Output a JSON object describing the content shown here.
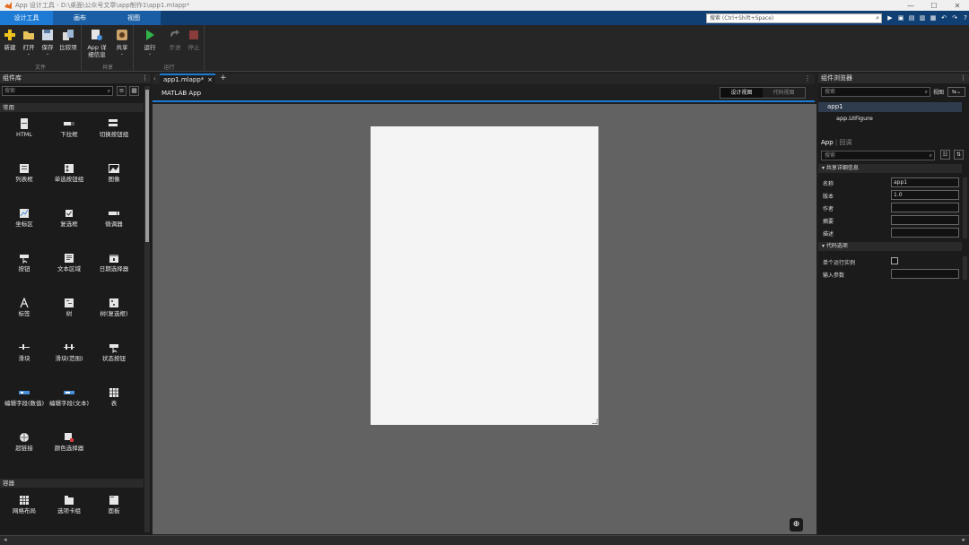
{
  "window": {
    "title": "App 设计工具 - D:\\桌面\\公众号文章\\app制作1\\app1.mlapp*",
    "controls": [
      "—",
      "☐",
      "✕"
    ]
  },
  "ribbon": {
    "tabs": [
      "设计工具",
      "画布",
      "视图"
    ],
    "search_placeholder": "搜索 (Ctrl+Shift+Space)"
  },
  "toolstrip": {
    "groups": {
      "file": "文件",
      "share": "共享",
      "run": "运行"
    },
    "tools": {
      "new": "新建",
      "open": "打开",
      "save": "保存",
      "compare": "比较项",
      "app_details": "App 详细信息",
      "share": "共享",
      "run": "运行",
      "step": "步进",
      "stop": "停止"
    }
  },
  "library": {
    "title": "组件库",
    "search_placeholder": "搜索",
    "sections": [
      "常用",
      "容器"
    ],
    "common": [
      "HTML",
      "下拉框",
      "切换按钮组",
      "列表框",
      "单选按钮组",
      "图像",
      "坐标区",
      "复选框",
      "微调器",
      "按钮",
      "文本区域",
      "日期选择器",
      "标签",
      "树",
      "树(复选框)",
      "滑块",
      "滑块(范围)",
      "状态按钮",
      "编辑字段(数值)",
      "编辑字段(文本)",
      "表",
      "超链接",
      "颜色选择器"
    ],
    "containers": [
      "网格布局",
      "选项卡组",
      "面板"
    ]
  },
  "editor": {
    "tab_label": "app1.mlapp*",
    "app_title": "MATLAB App",
    "view_design": "设计视图",
    "view_code": "代码视图"
  },
  "browser": {
    "title": "组件浏览器",
    "search_placeholder": "搜索",
    "view_label": "视图",
    "tree_root": "app1",
    "tree_child": "app.UIFigure",
    "tab_app": "App",
    "tab_callback": "回调",
    "inspector_search": "搜索",
    "section_details": "共享详细信息",
    "section_code": "代码选项",
    "props": {
      "name_label": "名称",
      "name_value": "app1",
      "version_label": "版本",
      "version_value": "1.0",
      "author_label": "作者",
      "summary_label": "摘要",
      "desc_label": "描述",
      "single_label": "单个运行实例",
      "input_label": "输入参数"
    }
  },
  "colors": {
    "accent": "#1d7bd6",
    "ribbon": "#0f3f73",
    "canvas": "#626262",
    "figure": "#f4f4f4"
  }
}
